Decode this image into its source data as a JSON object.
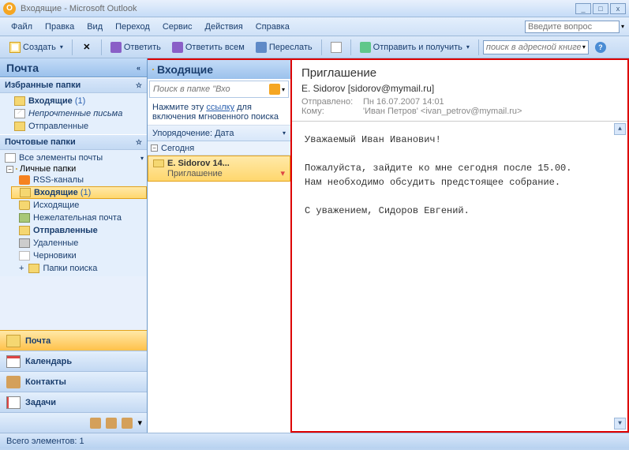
{
  "titlebar": {
    "title": "Входящие - Microsoft Outlook"
  },
  "menubar": {
    "items": [
      "Файл",
      "Правка",
      "Вид",
      "Переход",
      "Сервис",
      "Действия",
      "Справка"
    ],
    "help_placeholder": "Введите вопрос"
  },
  "toolbar": {
    "create": "Создать",
    "reply": "Ответить",
    "reply_all": "Ответить всем",
    "forward": "Переслать",
    "send_receive": "Отправить и получить",
    "addr_search_placeholder": "поиск в адресной книге"
  },
  "nav": {
    "header": "Почта",
    "fav_hdr": "Избранные папки",
    "fav_items": [
      {
        "label": "Входящие",
        "count": "(1)",
        "icon": "fic-inbox"
      },
      {
        "label": "Непрочтенные письма",
        "icon": "fic-mail",
        "italic": true
      },
      {
        "label": "Отправленные",
        "icon": "fic-sent"
      }
    ],
    "mail_hdr": "Почтовые папки",
    "all_items": "Все элементы почты",
    "personal": "Личные папки",
    "tree": [
      {
        "label": "RSS-каналы",
        "icon": "fic-rss"
      },
      {
        "label": "Входящие",
        "count": "(1)",
        "icon": "fic-inbox",
        "selected": true
      },
      {
        "label": "Исходящие",
        "icon": "fic-folder"
      },
      {
        "label": "Нежелательная почта",
        "icon": "fic-junk"
      },
      {
        "label": "Отправленные",
        "icon": "fic-sent",
        "bold": true
      },
      {
        "label": "Удаленные",
        "icon": "fic-trash"
      },
      {
        "label": "Черновики",
        "icon": "fic-draft"
      },
      {
        "label": "Папки поиска",
        "icon": "fic-search",
        "expand": "+"
      }
    ],
    "bottom": [
      {
        "label": "Почта",
        "icon": "bic-mail",
        "active": true
      },
      {
        "label": "Календарь",
        "icon": "bic-cal"
      },
      {
        "label": "Контакты",
        "icon": "bic-cont"
      },
      {
        "label": "Задачи",
        "icon": "bic-task"
      }
    ]
  },
  "list": {
    "header": "Входящие",
    "search_placeholder": "Поиск в папке \"Вхо",
    "instant_hint_pre": "Нажмите эту ",
    "instant_hint_link": "ссылку",
    "instant_hint_post": " для включения мгновенного поиска",
    "sort": "Упорядочение: Дата",
    "group": "Сегодня",
    "msg_from": "E. Sidorov 14...",
    "msg_subj": "Приглашение"
  },
  "reading": {
    "subject": "Приглашение",
    "from": "E. Sidorov [sidorov@mymail.ru]",
    "sent_label": "Отправлено:",
    "sent_value": "Пн 16.07.2007 14:01",
    "to_label": "Кому:",
    "to_value": "'Иван Петров' <ivan_petrov@mymail.ru>",
    "body_line1": "Уважаемый Иван Иванович!",
    "body_line2": "Пожалуйста, зайдите ко мне сегодня после 15.00.",
    "body_line3": "Нам необходимо обсудить предстоящее собрание.",
    "body_line4": "С уважением, Сидоров Евгений."
  },
  "status": {
    "text": "Всего элементов: 1"
  }
}
